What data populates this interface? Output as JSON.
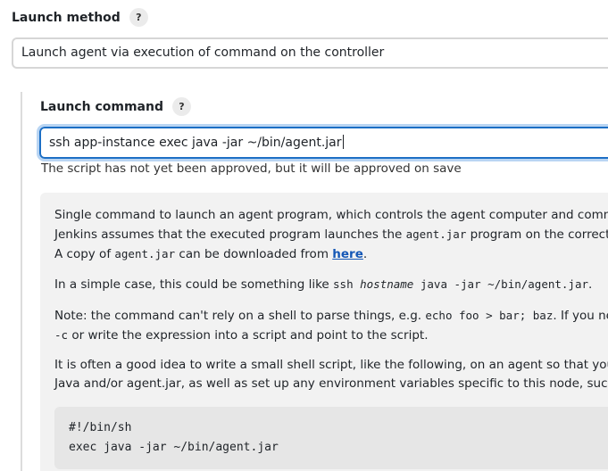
{
  "launch_method": {
    "label": "Launch method",
    "help_glyph": "?",
    "selected_value": "Launch agent via execution of command on the controller"
  },
  "launch_command": {
    "label": "Launch command",
    "help_glyph": "?",
    "value": "ssh app-instance exec java -jar ~/bin/agent.jar",
    "validation": "The script has not yet been approved, but it will be approved on save"
  },
  "help": {
    "p1_line1": "Single command to launch an agent program, which controls the agent computer and communicates",
    "p1_line2_a": "Jenkins assumes that the executed program launches the ",
    "p1_line2_code": "agent.jar",
    "p1_line2_b": " program on the correct machin",
    "p1_line3_a": "A copy of ",
    "p1_line3_code": "agent.jar",
    "p1_line3_b": " can be downloaded from ",
    "p1_link": "here",
    "p1_line3_c": ".",
    "p2_a": "In a simple case, this could be something like ",
    "p2_code1": "ssh ",
    "p2_code_italic": "hostname",
    "p2_code2": " java -jar ~/bin/agent.jar",
    "p2_b": ".",
    "p3_line1_a": "Note: the command can't rely on a shell to parse things, e.g. ",
    "p3_line1_code": "echo foo > bar; baz",
    "p3_line1_b": ". If you need to d",
    "p3_line2_code": "-c",
    "p3_line2_b": " or write the expression into a script and point to the script.",
    "p4_line1": "It is often a good idea to write a small shell script, like the following, on an agent so that you can cont",
    "p4_line2": "Java and/or agent.jar, as well as set up any environment variables specific to this node, such as PATH.",
    "code_line1": "#!/bin/sh",
    "code_line2": "exec java -jar ~/bin/agent.jar"
  }
}
